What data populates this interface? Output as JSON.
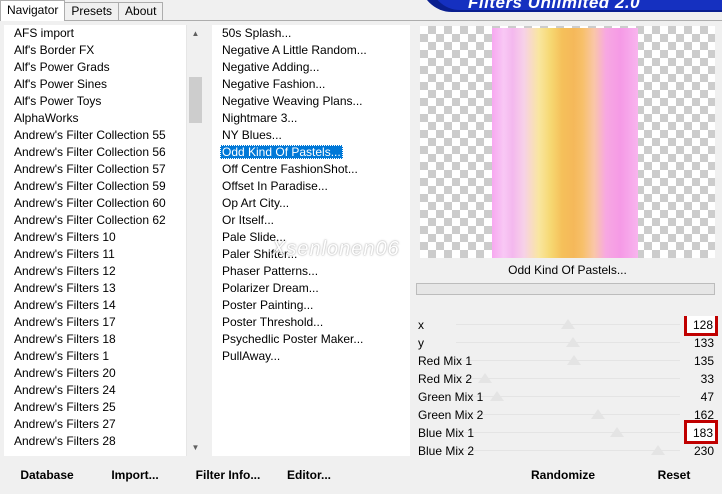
{
  "tabs": [
    {
      "label": "Navigator"
    },
    {
      "label": "Presets"
    },
    {
      "label": "About"
    }
  ],
  "banner_title": "Filters Unlimited 2.0",
  "categories": [
    "AFS import",
    "Alf's Border FX",
    "Alf's Power Grads",
    "Alf's Power Sines",
    "Alf's Power Toys",
    "AlphaWorks",
    "Andrew's Filter Collection 55",
    "Andrew's Filter Collection 56",
    "Andrew's Filter Collection 57",
    "Andrew's Filter Collection 59",
    "Andrew's Filter Collection 60",
    "Andrew's Filter Collection 62",
    "Andrew's Filters 10",
    "Andrew's Filters 11",
    "Andrew's Filters 12",
    "Andrew's Filters 13",
    "Andrew's Filters 14",
    "Andrew's Filters 17",
    "Andrew's Filters 18",
    "Andrew's Filters 1",
    "Andrew's Filters 20",
    "Andrew's Filters 24",
    "Andrew's Filters 25",
    "Andrew's Filters 27",
    "Andrew's Filters 28"
  ],
  "filters": [
    "50s Splash...",
    "Negative A Little Random...",
    "Negative Adding...",
    "Negative Fashion...",
    "Negative Weaving Plans...",
    "Nightmare 3...",
    "NY Blues...",
    "Odd Kind Of Pastels...",
    "Off Centre FashionShot...",
    "Offset In Paradise...",
    "Op Art City...",
    "Or Itself...",
    "Pale Slide...",
    "Paler Shifter...",
    "Phaser Patterns...",
    "Polarizer Dream...",
    "Poster Painting...",
    "Poster Threshold...",
    "Psychedlic Poster Maker...",
    "PullAway..."
  ],
  "selected_filter_index": 7,
  "preview": {
    "caption": "Odd Kind Of Pastels...",
    "watermark": "Xsenlonen06"
  },
  "parameters": [
    {
      "label": "x",
      "value": "128",
      "level": 0.502,
      "highlighted": true
    },
    {
      "label": "y",
      "value": "133",
      "level": 0.522,
      "highlighted": false
    },
    {
      "label": "Red Mix 1",
      "value": "135",
      "level": 0.529,
      "highlighted": false
    },
    {
      "label": "Red Mix 2",
      "value": "33",
      "level": 0.129,
      "highlighted": false
    },
    {
      "label": "Green Mix 1",
      "value": "47",
      "level": 0.184,
      "highlighted": false
    },
    {
      "label": "Green Mix 2",
      "value": "162",
      "level": 0.635,
      "highlighted": false
    },
    {
      "label": "Blue Mix 1",
      "value": "183",
      "level": 0.718,
      "highlighted": true
    },
    {
      "label": "Blue Mix 2",
      "value": "230",
      "level": 0.902,
      "highlighted": false
    }
  ],
  "buttons": {
    "database": "Database",
    "import": "Import...",
    "filter_info": "Filter Info...",
    "editor": "Editor...",
    "randomize": "Randomize",
    "reset": "Reset"
  },
  "colors": {
    "highlight_box": "#c00000",
    "selection": "#0078d7",
    "banner": "#1530c0"
  }
}
